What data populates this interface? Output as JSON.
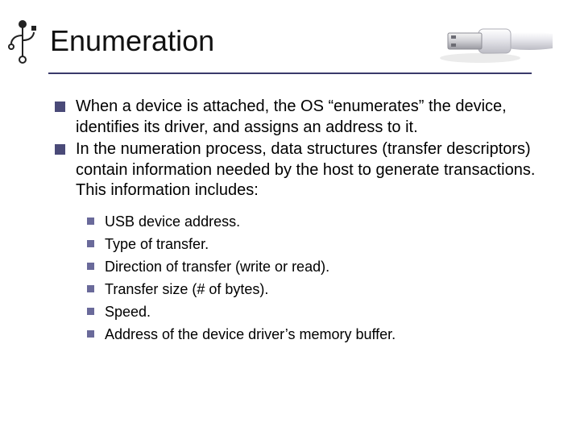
{
  "title": "Enumeration",
  "bullets": [
    "When a device is attached, the OS “enumerates” the device, identifies its driver, and assigns an address to it.",
    "In the numeration process, data structures (transfer descriptors) contain information needed by the host to generate transactions. This information includes:"
  ],
  "subbullets": [
    "USB device address.",
    "Type of transfer.",
    "Direction of transfer (write or read).",
    "Transfer size (# of bytes).",
    "Speed.",
    "Address of the device driver’s memory buffer."
  ]
}
